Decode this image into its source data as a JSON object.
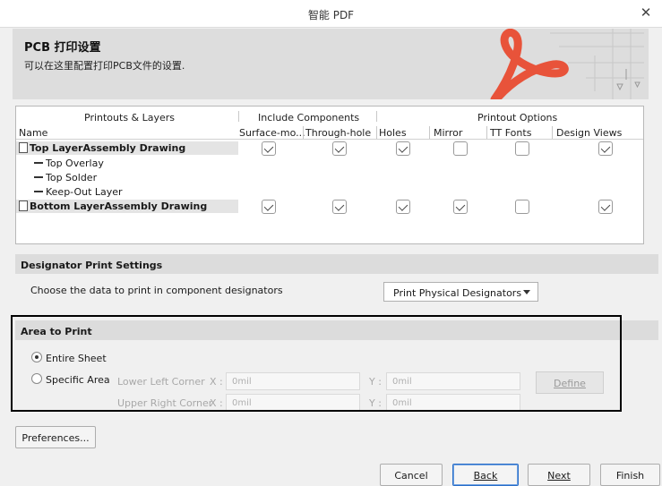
{
  "window": {
    "title": "智能 PDF",
    "close_icon": "close-icon"
  },
  "header": {
    "title": "PCB 打印设置",
    "subtitle": "可以在这里配置打印PCB文件的设置."
  },
  "layers_table": {
    "group_headers": {
      "printouts": "Printouts & Layers",
      "include_components": "Include Components",
      "printout_options": "Printout Options"
    },
    "columns": [
      "Name",
      "Surface-mo...",
      "Through-hole",
      "Holes",
      "Mirror",
      "TT Fonts",
      "Design Views"
    ],
    "rows": [
      {
        "name": "Top LayerAssembly Drawing",
        "type": "printout",
        "surface_mount": true,
        "through_hole": true,
        "holes": true,
        "mirror": false,
        "tt_fonts": false,
        "design_views": true
      },
      {
        "name": "Top Overlay",
        "type": "layer"
      },
      {
        "name": "Top Solder",
        "type": "layer"
      },
      {
        "name": "Keep-Out Layer",
        "type": "layer"
      },
      {
        "name": "Bottom LayerAssembly Drawing",
        "type": "printout",
        "surface_mount": true,
        "through_hole": true,
        "holes": true,
        "mirror": true,
        "tt_fonts": false,
        "design_views": true
      }
    ]
  },
  "designator": {
    "section_title": "Designator Print Settings",
    "label": "Choose the data to print in component designators",
    "selected": "Print Physical Designators"
  },
  "area": {
    "section_title": "Area to Print",
    "entire_sheet": "Entire Sheet",
    "specific_area": "Specific Area",
    "selected": "Entire Sheet",
    "lower_left_label": "Lower Left Corner",
    "upper_right_label": "Upper Right Corner",
    "x_label": "X :",
    "y_label": "Y :",
    "lower_left_x": "0mil",
    "lower_left_y": "0mil",
    "upper_right_x": "0mil",
    "upper_right_y": "0mil",
    "define_label": "Define"
  },
  "buttons": {
    "preferences": "Preferences...",
    "cancel": "Cancel",
    "back": "Back",
    "next": "Next",
    "finish": "Finish"
  },
  "colors": {
    "accent_logo": "#e8533a",
    "banner_bg": "#dddddd",
    "primary_border": "#2a6fc9"
  }
}
